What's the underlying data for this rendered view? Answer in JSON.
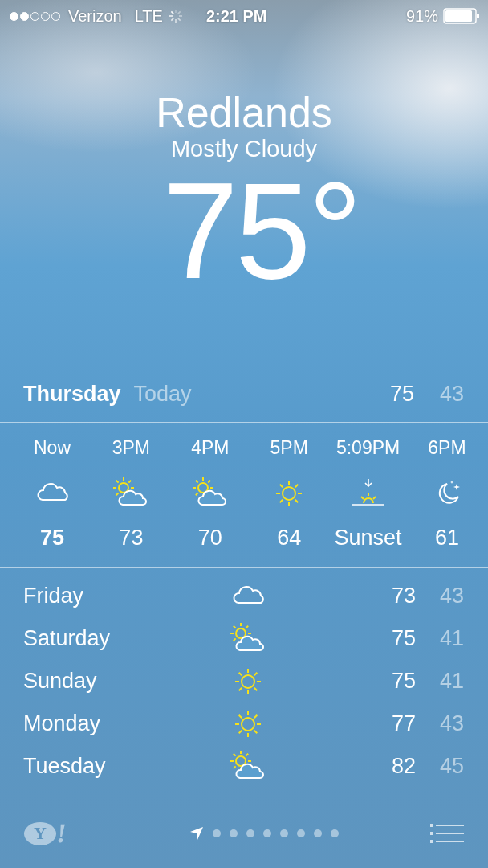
{
  "status_bar": {
    "carrier": "Verizon",
    "network": "LTE",
    "time": "2:21 PM",
    "battery": "91%"
  },
  "header": {
    "city": "Redlands",
    "condition": "Mostly Cloudy",
    "temperature": "75°"
  },
  "today": {
    "day": "Thursday",
    "label": "Today",
    "high": "75",
    "low": "43"
  },
  "hourly": [
    {
      "time": "Now",
      "kind": "cloudy",
      "value": "75",
      "current": true
    },
    {
      "time": "3PM",
      "kind": "partly-cloudy",
      "value": "73",
      "current": false
    },
    {
      "time": "4PM",
      "kind": "partly-cloudy",
      "value": "70",
      "current": false
    },
    {
      "time": "5PM",
      "kind": "sunny",
      "value": "64",
      "current": false
    },
    {
      "time": "5:09PM",
      "kind": "sunset",
      "value": "Sunset",
      "current": false
    },
    {
      "time": "6PM",
      "kind": "night",
      "value": "61",
      "current": false
    }
  ],
  "daily": [
    {
      "day": "Friday",
      "kind": "cloudy",
      "high": "73",
      "low": "43"
    },
    {
      "day": "Saturday",
      "kind": "partly-cloudy",
      "high": "75",
      "low": "41"
    },
    {
      "day": "Sunday",
      "kind": "sunny",
      "high": "75",
      "low": "41"
    },
    {
      "day": "Monday",
      "kind": "sunny",
      "high": "77",
      "low": "43"
    },
    {
      "day": "Tuesday",
      "kind": "partly-cloudy",
      "high": "82",
      "low": "45"
    }
  ],
  "footer": {
    "logo_letter": "Y",
    "logo_mark": "!",
    "pages": [
      {
        "kind": "location",
        "selected": true
      },
      {
        "kind": "dot",
        "selected": false
      },
      {
        "kind": "dot",
        "selected": false
      },
      {
        "kind": "dot",
        "selected": false
      },
      {
        "kind": "dot",
        "selected": false
      },
      {
        "kind": "dot",
        "selected": false
      },
      {
        "kind": "dot",
        "selected": false
      },
      {
        "kind": "dot",
        "selected": false
      },
      {
        "kind": "dot",
        "selected": false
      }
    ]
  }
}
